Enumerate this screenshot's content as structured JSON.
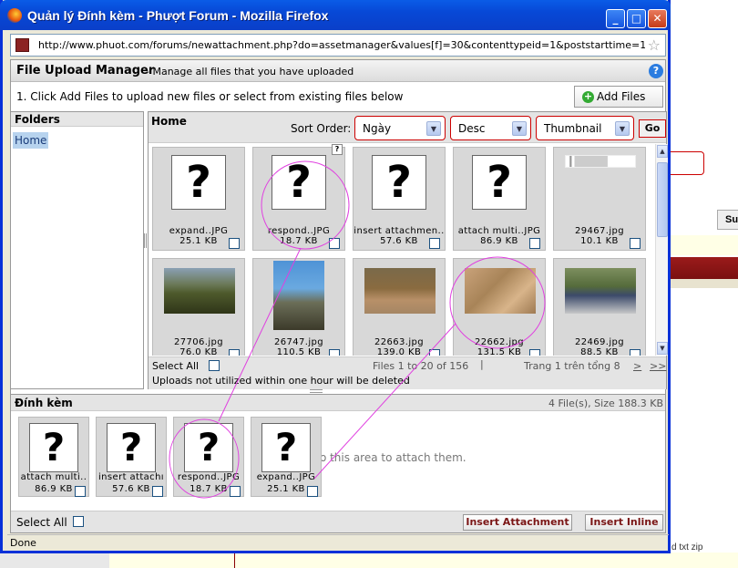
{
  "window": {
    "title": "Quản lý Đính kèm - Phượt Forum - Mozilla Firefox",
    "url": "http://www.phuot.com/forums/newattachment.php?do=assetmanager&values[f]=30&contenttypeid=1&poststarttime=1269789207&po",
    "minimize": "_",
    "maximize": "□",
    "close": "✕",
    "status": "Done"
  },
  "manager": {
    "title": "File Upload Manager",
    "subtitle": "- Manage all files that you have uploaded",
    "help": "?",
    "instruction": "1. Click Add Files to upload new files or select from existing files below",
    "add_files": "Add Files"
  },
  "folders": {
    "header": "Folders",
    "items": [
      "Home"
    ]
  },
  "toolbar": {
    "folder": "Home",
    "sort_label": "Sort Order:",
    "sort_field": "Ngày",
    "sort_dir": "Desc",
    "view": "Thumbnail",
    "go": "Go"
  },
  "files": [
    {
      "name": "expand..JPG",
      "size": "25.1 KB",
      "thumb": "question-placeholder"
    },
    {
      "name": "respond..JPG",
      "size": "18.7 KB",
      "thumb": "question-placeholder"
    },
    {
      "name": "insert attachmen..",
      "size": "57.6 KB",
      "thumb": "question-placeholder"
    },
    {
      "name": "attach multi..JPG",
      "size": "86.9 KB",
      "thumb": "question-placeholder"
    },
    {
      "name": "29467.jpg",
      "size": "10.1 KB",
      "thumb": "document"
    },
    {
      "name": "27706.jpg",
      "size": "76.0 KB",
      "thumb": "landscape"
    },
    {
      "name": "26747.jpg",
      "size": "110.5 KB",
      "thumb": "windmill"
    },
    {
      "name": "22663.jpg",
      "size": "139.0 KB",
      "thumb": "village"
    },
    {
      "name": "22662.jpg",
      "size": "131.5 KB",
      "thumb": "rocks"
    },
    {
      "name": "22469.jpg",
      "size": "88.5 KB",
      "thumb": "people"
    }
  ],
  "grid_footer": {
    "select_all": "Select All",
    "files_count": "Files 1 to 20 of 156",
    "separator": "|",
    "page": "Trang 1 trên tổng 8",
    "next": ">",
    "last": ">>",
    "warning": "Uploads not utilized within one hour will be deleted"
  },
  "attachments": {
    "title": "Đính kèm",
    "summary": "4 File(s), Size 188.3 KB",
    "drop_hint": "Drag files into this area to attach them.",
    "items": [
      {
        "name": "attach multi..",
        "size": "86.9 KB"
      },
      {
        "name": "insert attachı",
        "size": "57.6 KB"
      },
      {
        "name": "respond..JPG",
        "size": "18.7 KB"
      },
      {
        "name": "expand..JPG",
        "size": "25.1 KB"
      }
    ],
    "select_all": "Select All",
    "insert_attachment": "Insert Attachment",
    "insert_inline": "Insert Inline"
  },
  "background": {
    "button": "Su",
    "footer_text": "d txt zip"
  },
  "colors": {
    "annotation": "#e040e0",
    "titlebar": "#0a5ce7",
    "selected_folder": "#b7d3ee"
  }
}
